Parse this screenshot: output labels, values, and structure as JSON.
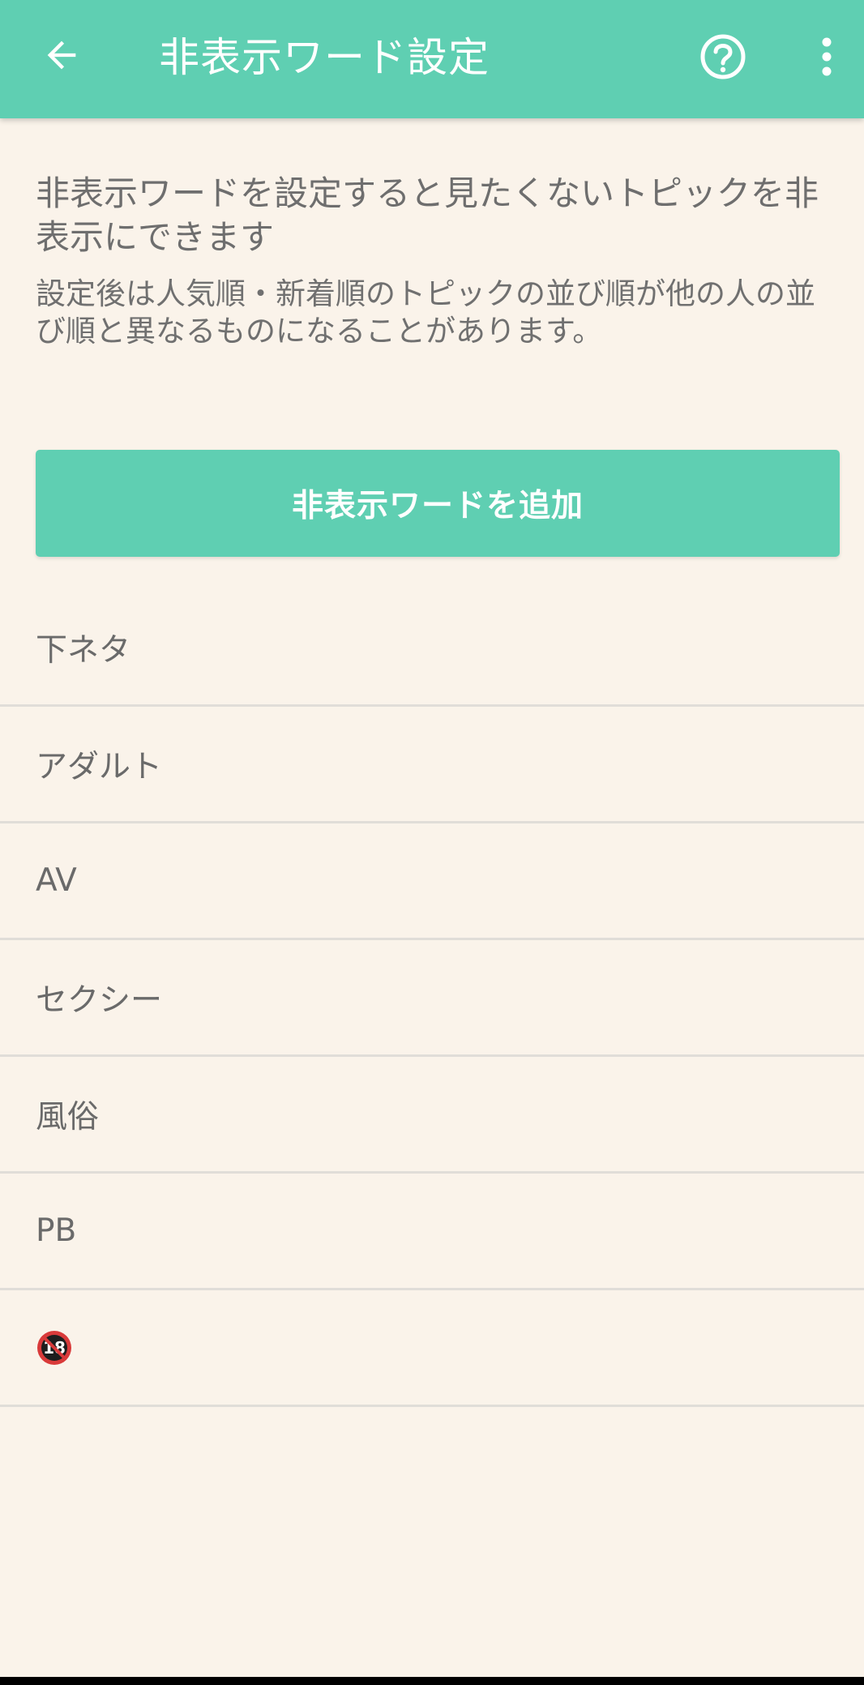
{
  "colors": {
    "accent": "#5fcfb2",
    "background": "#faf3ea",
    "text": "#6e6e6e",
    "divider": "#e0ddd8"
  },
  "appbar": {
    "title": "非表示ワード設定",
    "back_icon": "arrow-left-icon",
    "help_icon": "help-circle-icon",
    "more_icon": "more-vert-icon"
  },
  "intro": {
    "headline": "非表示ワードを設定すると見たくないトピックを非表示にできます",
    "note": "設定後は人気順・新着順のトピックの並び順が他の人の並び順と異なるものになることがあります。"
  },
  "add_button": {
    "label": "非表示ワードを追加"
  },
  "words": [
    {
      "label": "下ネタ"
    },
    {
      "label": "アダルト"
    },
    {
      "label": "AV"
    },
    {
      "label": "セクシー"
    },
    {
      "label": "風俗"
    },
    {
      "label": "PB"
    },
    {
      "icon": "under-18-prohibited-icon"
    }
  ]
}
